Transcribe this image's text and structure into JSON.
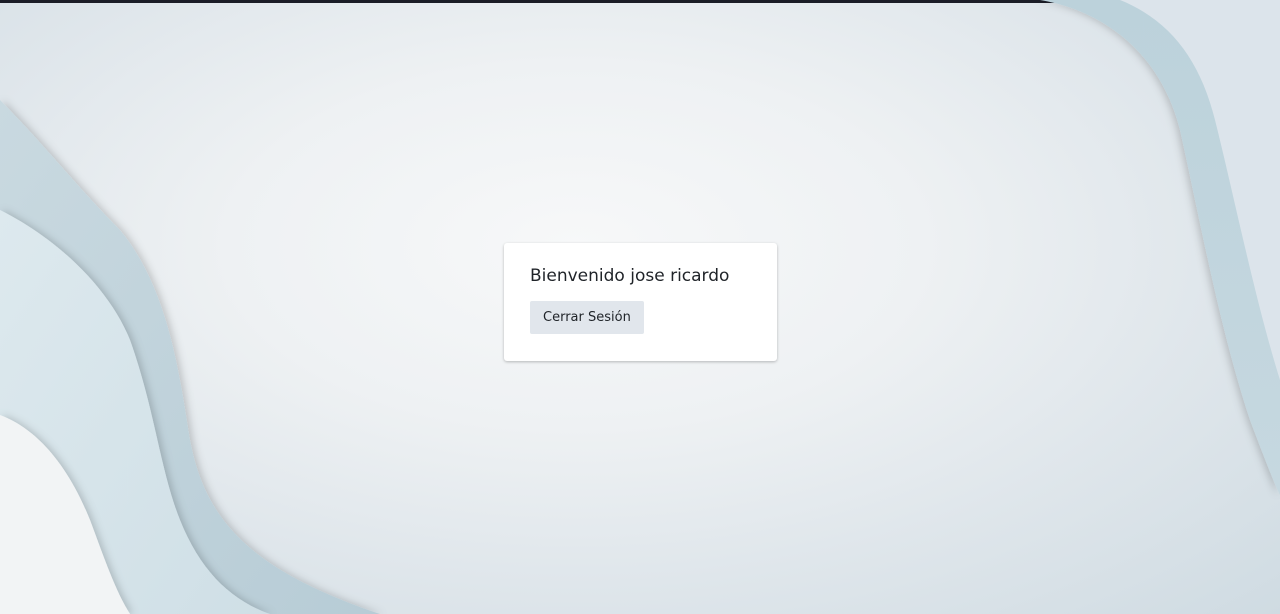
{
  "card": {
    "welcome_text": "Bienvenido jose ricardo",
    "logout_label": "Cerrar Sesión"
  },
  "colors": {
    "card_background": "#ffffff",
    "button_background": "#e1e6ec",
    "top_strip": "#1b1d27",
    "wave_light": "#d9e6ec",
    "wave_mid": "#bfd3dc"
  }
}
